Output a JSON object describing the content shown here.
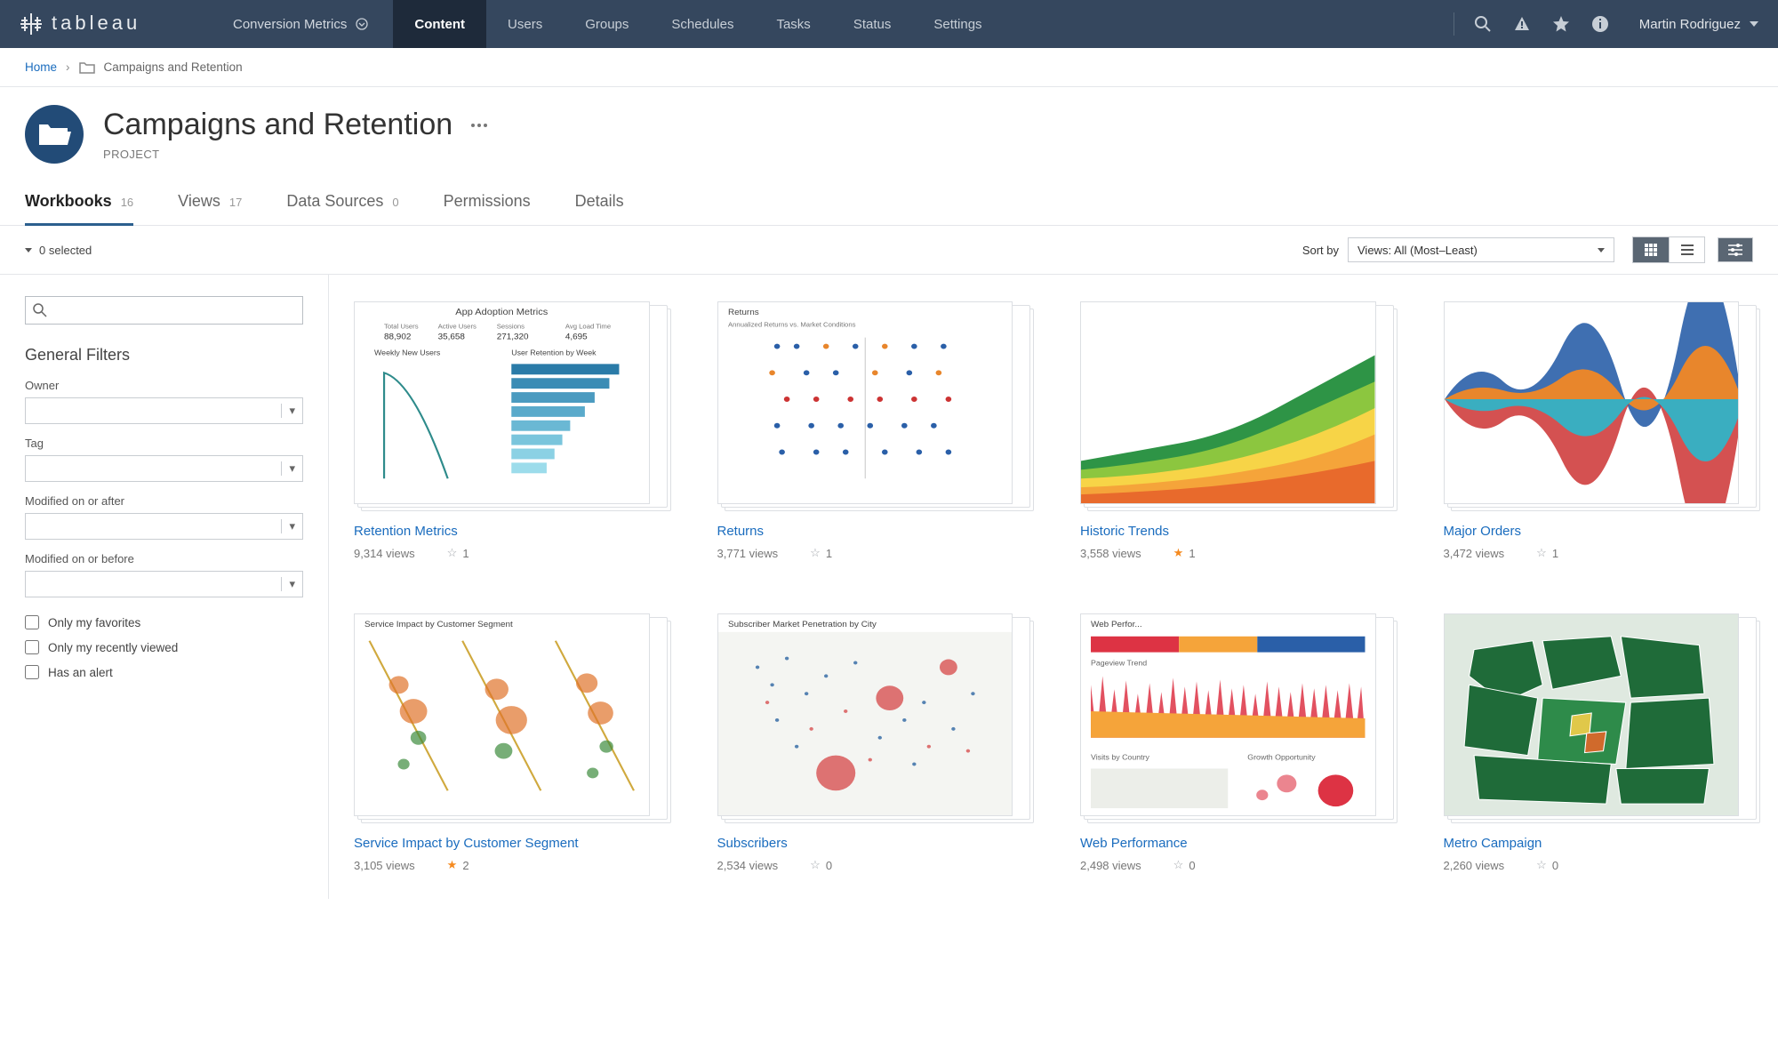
{
  "topnav": {
    "site_label": "Conversion Metrics",
    "links": [
      "Content",
      "Users",
      "Groups",
      "Schedules",
      "Tasks",
      "Status",
      "Settings"
    ],
    "active_index": 0,
    "user": "Martin Rodriguez"
  },
  "breadcrumb": {
    "home": "Home",
    "current": "Campaigns and Retention"
  },
  "project": {
    "title": "Campaigns and Retention",
    "subtitle": "PROJECT"
  },
  "tabs": [
    {
      "label": "Workbooks",
      "count": "16",
      "active": true
    },
    {
      "label": "Views",
      "count": "17"
    },
    {
      "label": "Data Sources",
      "count": "0"
    },
    {
      "label": "Permissions",
      "count": ""
    },
    {
      "label": "Details",
      "count": ""
    }
  ],
  "toolbar": {
    "selected": "0 selected",
    "sort_label": "Sort by",
    "sort_value": "Views: All (Most–Least)"
  },
  "filters": {
    "heading": "General Filters",
    "owner_label": "Owner",
    "tag_label": "Tag",
    "mod_after_label": "Modified on or after",
    "mod_before_label": "Modified on or before",
    "fav_label": "Only my favorites",
    "recent_label": "Only my recently viewed",
    "alert_label": "Has an alert"
  },
  "cards": [
    {
      "title": "Retention Metrics",
      "views": "9,314 views",
      "fav": "1",
      "starred": false
    },
    {
      "title": "Returns",
      "views": "3,771 views",
      "fav": "1",
      "starred": false
    },
    {
      "title": "Historic Trends",
      "views": "3,558 views",
      "fav": "1",
      "starred": true
    },
    {
      "title": "Major Orders",
      "views": "3,472 views",
      "fav": "1",
      "starred": false
    },
    {
      "title": "Service Impact by Customer Segment",
      "views": "3,105 views",
      "fav": "2",
      "starred": true
    },
    {
      "title": "Subscribers",
      "views": "2,534 views",
      "fav": "0",
      "starred": false
    },
    {
      "title": "Web Performance",
      "views": "2,498 views",
      "fav": "0",
      "starred": false
    },
    {
      "title": "Metro Campaign",
      "views": "2,260 views",
      "fav": "0",
      "starred": false
    }
  ]
}
